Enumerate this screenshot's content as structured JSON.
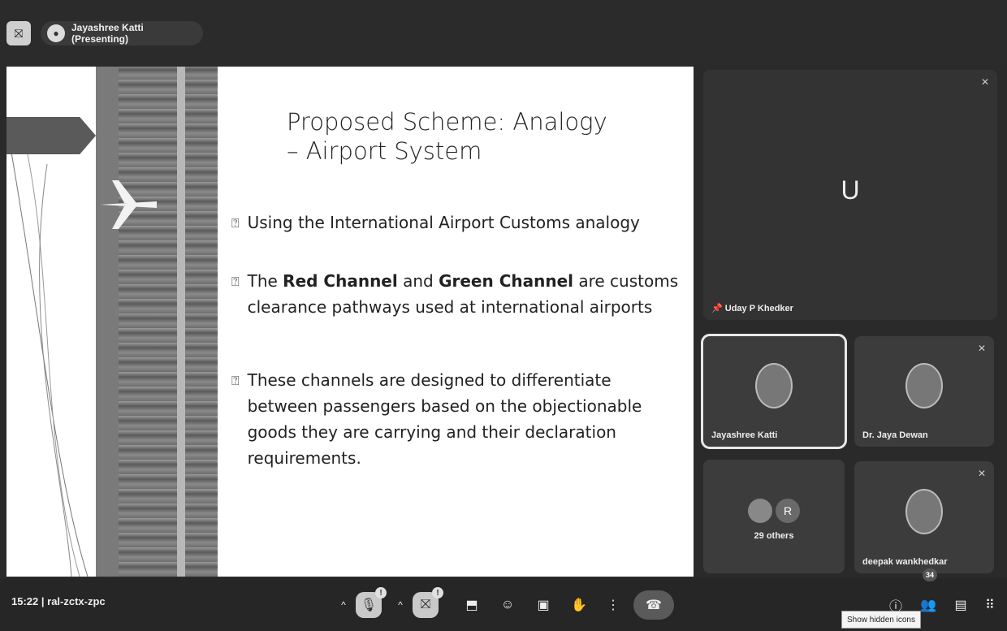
{
  "topbar": {
    "presenter_label": "Jayashree Katti (Presenting)"
  },
  "slide": {
    "title_line1": "Proposed Scheme: Analogy",
    "title_line2": "– Airport System",
    "bullet_mark": "⍰",
    "bullet1": "Using the International Airport Customs analogy",
    "bullet2_pre": "The ",
    "bullet2_bold1": "Red Channel",
    "bullet2_mid": " and ",
    "bullet2_bold2": "Green Channel",
    "bullet2_post": " are customs clearance pathways used at international airports",
    "bullet3": "These channels are designed to differentiate between passengers based on the objectionable goods they are carrying and their declaration requirements."
  },
  "participants": {
    "main": {
      "initial": "U",
      "name": "Uday P Khedker"
    },
    "p1": {
      "name": "Jayashree Katti"
    },
    "p2": {
      "name": "Dr. Jaya Dewan"
    },
    "others": {
      "initial": "R",
      "label": "29 others"
    },
    "p3": {
      "name": "deepak wankhedkar"
    }
  },
  "bottombar": {
    "time": "15:22",
    "separator": "|",
    "meeting_code": "ral-zctx-zpc",
    "people_count": "34",
    "mic_badge": "!",
    "cam_badge": "!"
  },
  "tooltip": "Show hidden icons",
  "colors": {
    "background": "#2a2a2a",
    "slide": "#ffffff",
    "tile": "#3c3c3c"
  }
}
